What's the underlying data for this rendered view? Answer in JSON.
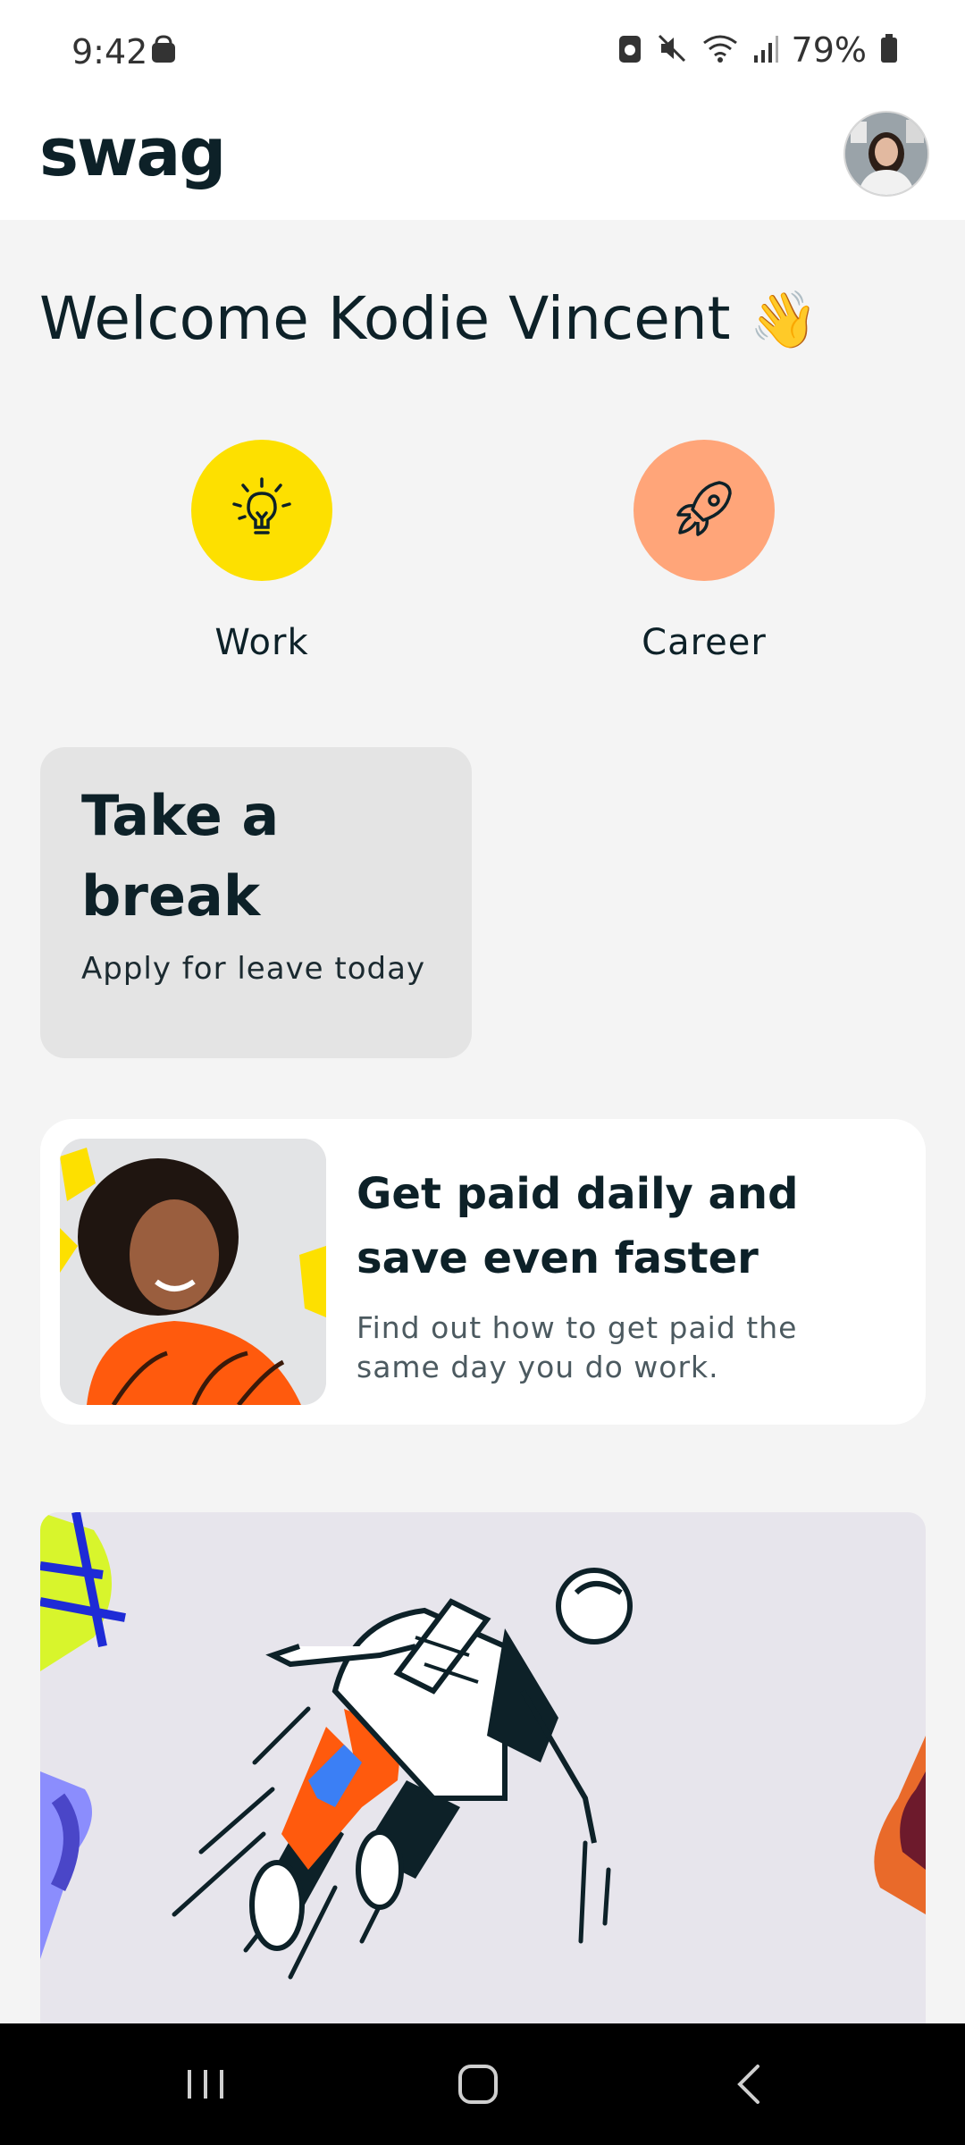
{
  "status_bar": {
    "time": "9:42",
    "battery": "79%"
  },
  "app": {
    "logo": "swag"
  },
  "welcome": {
    "text": "Welcome Kodie Vincent",
    "emoji": "👋"
  },
  "quick_actions": [
    {
      "label": "Work",
      "icon": "lightbulb-icon",
      "color": "#fde000"
    },
    {
      "label": "Career",
      "icon": "rocket-icon",
      "color": "#ffa579"
    }
  ],
  "break_card": {
    "title": "Take a break",
    "subtitle": "Apply for leave today"
  },
  "pay_card": {
    "title": "Get paid daily and save even faster",
    "subtitle": "Find out how to get paid the same day you do work."
  },
  "colors": {
    "background": "#f4f4f4",
    "text": "#0d2128",
    "break_card": "#e4e4e4",
    "promo": "#e7e5ec"
  }
}
